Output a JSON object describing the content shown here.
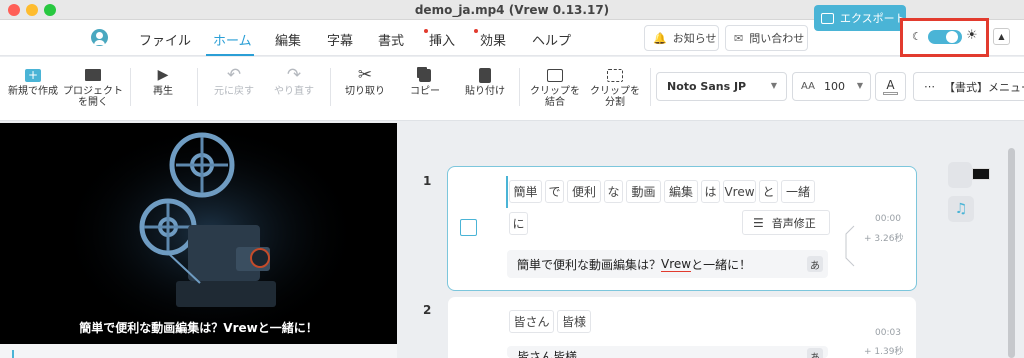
{
  "window": {
    "title": "demo_ja.mp4 (Vrew 0.13.17)"
  },
  "menu": {
    "tabs": [
      {
        "label": "ファイル"
      },
      {
        "label": "ホーム"
      },
      {
        "label": "編集"
      },
      {
        "label": "字幕"
      },
      {
        "label": "書式"
      },
      {
        "label": "挿入"
      },
      {
        "label": "効果"
      },
      {
        "label": "ヘルプ"
      }
    ],
    "active_tab": "ホーム",
    "notice_label": "お知らせ",
    "contact_label": "問い合わせ",
    "export_label": "エクスポート",
    "dark_mode_icon": "moon-icon",
    "light_mode_icon": "sun-icon",
    "theme_toggle_on": true,
    "accent": "#4ab4d6",
    "highlight": "#e23b2e"
  },
  "toolbar": {
    "new_label": "新規で作成",
    "open_label_1": "プロジェクト",
    "open_label_2": "を開く",
    "play_label": "再生",
    "undo_label": "元に戻す",
    "redo_label": "やり直す",
    "cut_label": "切り取り",
    "copy_label": "コピー",
    "paste_label": "貼り付け",
    "merge_label_1": "クリップを",
    "merge_label_2": "結合",
    "split_label_1": "クリップを",
    "split_label_2": "分割",
    "font_value": "Noto Sans JP",
    "font_size_value": "100",
    "font_color_label": "A",
    "more_label": "【書式】メニュー"
  },
  "video": {
    "caption": "簡単で便利な動画編集は？Vrewと一緒に！"
  },
  "clips": [
    {
      "number": "1",
      "words_row1": [
        "簡単",
        "で",
        "便利",
        "な",
        "動画",
        "編集",
        "は",
        "Vrew",
        "と",
        "一緒"
      ],
      "words_row2": [
        "に"
      ],
      "audio_label": "音声修正",
      "start_time": "00:00",
      "duration": "+ 3.26秒",
      "subtitle_before": "簡単で便利な動画編集は？",
      "subtitle_underlined": "Vrew",
      "subtitle_after": "と一緒に！",
      "lang_badge": "あ"
    },
    {
      "number": "2",
      "words_row1": [
        "皆さん",
        "皆様"
      ],
      "start_time": "00:03",
      "duration": "+ 1.39秒",
      "subtitle": "皆さん皆様",
      "lang_badge": "あ"
    }
  ]
}
